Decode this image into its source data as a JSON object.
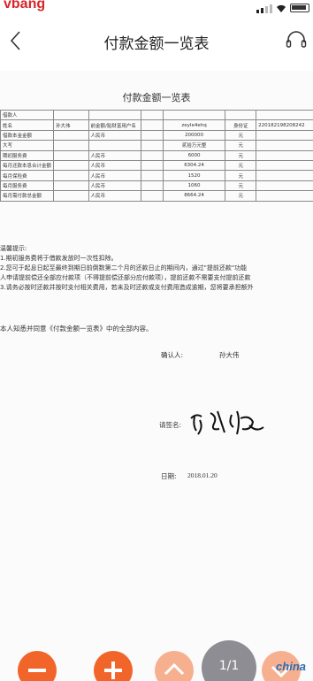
{
  "status_bar": {
    "carrier_logo": "vbang"
  },
  "nav": {
    "title": "付款金额一览表"
  },
  "document": {
    "title": "付款金额一览表",
    "table": [
      [
        "借款人",
        "",
        "",
        "",
        "",
        "",
        ""
      ],
      [
        "姓名",
        "孙大伟",
        "前金额/贴财富用户名",
        "",
        "zeyle4ehq",
        "身份证",
        "220182198208242"
      ],
      [
        "借款本金金额",
        "",
        "人民币",
        "",
        "200000",
        "元",
        ""
      ],
      [
        "大写",
        "",
        "",
        "",
        "贰拾万元整",
        "元",
        ""
      ],
      [
        "期初服务费",
        "",
        "人民币",
        "",
        "6000",
        "元",
        ""
      ],
      [
        "每月还款本息合计金额",
        "",
        "人民币",
        "",
        "6304.24",
        "元",
        ""
      ],
      [
        "每月保险费",
        "",
        "人民币",
        "",
        "1520",
        "元",
        ""
      ],
      [
        "每月服务费",
        "",
        "人民币",
        "",
        "1060",
        "元",
        ""
      ],
      [
        "每月需付款总金额",
        "",
        "人民币",
        "",
        "8664.24",
        "元",
        ""
      ]
    ],
    "notes": [
      "温馨提示:",
      "1.期初服务费将于借款发放时一次性扣除。",
      "2.您可于起息日起至最终到期日前倒数第二个月的还款日止的期间内，通过\"提前还款\"功能",
      "人申请提前偿还全部应付款项（不得提前偿还部分应付款项），提前还款不需要支付提前还款",
      "3.请务必按时还款并按时支付相关费用，若未及时还款或支付费用造成逾期，您将要承担额外"
    ],
    "consent": "本人知悉并同意《付款金额一览表》中的全部内容。",
    "confirm_label": "确认人:",
    "confirm_name": "孙大伟",
    "sign_label": "请签名:",
    "date_label": "日期:",
    "date_value": "2018.01.20"
  },
  "watermark": "china",
  "toolbar": {
    "page_indicator": "1/1"
  },
  "colors": {
    "accent": "#f2652a",
    "accent_light": "#f7b08f",
    "page_badge": "#8d8d93"
  }
}
